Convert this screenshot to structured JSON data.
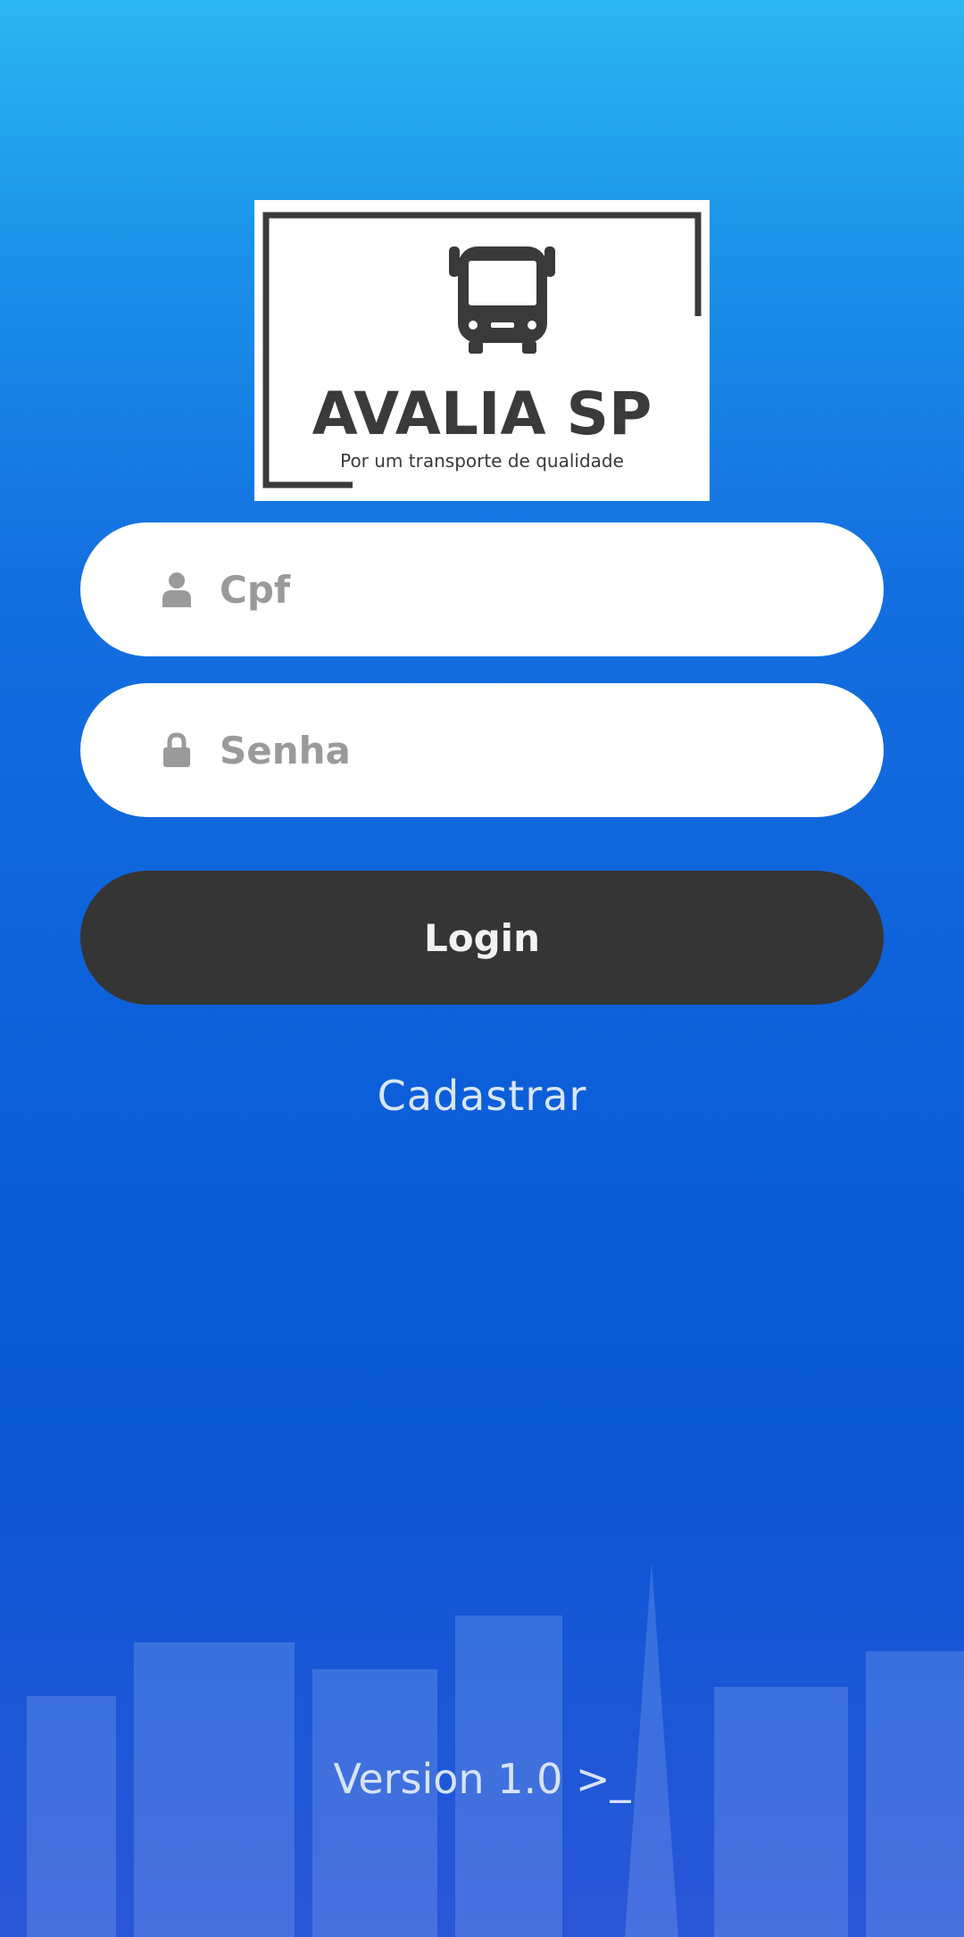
{
  "colors": {
    "background_top": "#2ab7f2",
    "background_bottom": "#0b57d6",
    "button_background": "#353535",
    "input_background": "#ffffff",
    "placeholder_text": "#9a9a9a"
  },
  "logo": {
    "title": "AVALIA SP",
    "tagline": "Por um transporte de qualidade",
    "icon": "bus-icon"
  },
  "form": {
    "cpf": {
      "placeholder": "Cpf",
      "value": "",
      "icon": "user-icon"
    },
    "senha": {
      "placeholder": "Senha",
      "value": "",
      "icon": "lock-icon"
    },
    "login_label": "Login",
    "register_label": "Cadastrar"
  },
  "footer": {
    "version": "Version 1.0 >_"
  }
}
